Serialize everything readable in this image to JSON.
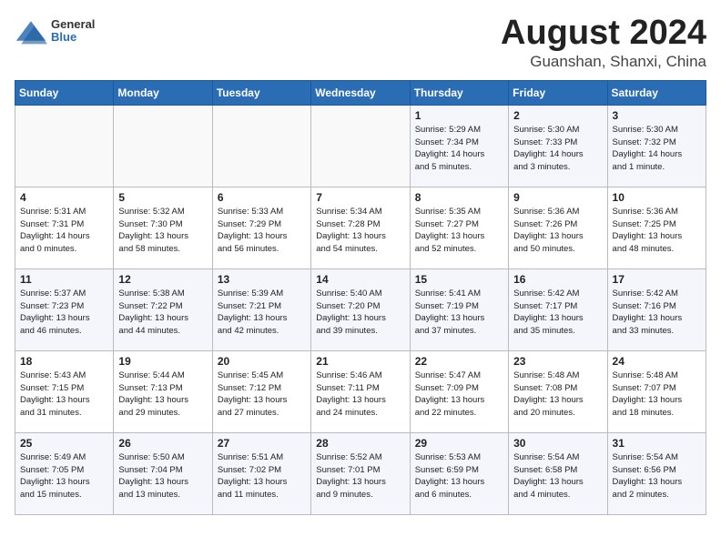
{
  "header": {
    "logo_general": "General",
    "logo_blue": "Blue",
    "month_title": "August 2024",
    "location": "Guanshan, Shanxi, China"
  },
  "days_of_week": [
    "Sunday",
    "Monday",
    "Tuesday",
    "Wednesday",
    "Thursday",
    "Friday",
    "Saturday"
  ],
  "weeks": [
    [
      {
        "day": "",
        "info": ""
      },
      {
        "day": "",
        "info": ""
      },
      {
        "day": "",
        "info": ""
      },
      {
        "day": "",
        "info": ""
      },
      {
        "day": "1",
        "info": "Sunrise: 5:29 AM\nSunset: 7:34 PM\nDaylight: 14 hours\nand 5 minutes."
      },
      {
        "day": "2",
        "info": "Sunrise: 5:30 AM\nSunset: 7:33 PM\nDaylight: 14 hours\nand 3 minutes."
      },
      {
        "day": "3",
        "info": "Sunrise: 5:30 AM\nSunset: 7:32 PM\nDaylight: 14 hours\nand 1 minute."
      }
    ],
    [
      {
        "day": "4",
        "info": "Sunrise: 5:31 AM\nSunset: 7:31 PM\nDaylight: 14 hours\nand 0 minutes."
      },
      {
        "day": "5",
        "info": "Sunrise: 5:32 AM\nSunset: 7:30 PM\nDaylight: 13 hours\nand 58 minutes."
      },
      {
        "day": "6",
        "info": "Sunrise: 5:33 AM\nSunset: 7:29 PM\nDaylight: 13 hours\nand 56 minutes."
      },
      {
        "day": "7",
        "info": "Sunrise: 5:34 AM\nSunset: 7:28 PM\nDaylight: 13 hours\nand 54 minutes."
      },
      {
        "day": "8",
        "info": "Sunrise: 5:35 AM\nSunset: 7:27 PM\nDaylight: 13 hours\nand 52 minutes."
      },
      {
        "day": "9",
        "info": "Sunrise: 5:36 AM\nSunset: 7:26 PM\nDaylight: 13 hours\nand 50 minutes."
      },
      {
        "day": "10",
        "info": "Sunrise: 5:36 AM\nSunset: 7:25 PM\nDaylight: 13 hours\nand 48 minutes."
      }
    ],
    [
      {
        "day": "11",
        "info": "Sunrise: 5:37 AM\nSunset: 7:23 PM\nDaylight: 13 hours\nand 46 minutes."
      },
      {
        "day": "12",
        "info": "Sunrise: 5:38 AM\nSunset: 7:22 PM\nDaylight: 13 hours\nand 44 minutes."
      },
      {
        "day": "13",
        "info": "Sunrise: 5:39 AM\nSunset: 7:21 PM\nDaylight: 13 hours\nand 42 minutes."
      },
      {
        "day": "14",
        "info": "Sunrise: 5:40 AM\nSunset: 7:20 PM\nDaylight: 13 hours\nand 39 minutes."
      },
      {
        "day": "15",
        "info": "Sunrise: 5:41 AM\nSunset: 7:19 PM\nDaylight: 13 hours\nand 37 minutes."
      },
      {
        "day": "16",
        "info": "Sunrise: 5:42 AM\nSunset: 7:17 PM\nDaylight: 13 hours\nand 35 minutes."
      },
      {
        "day": "17",
        "info": "Sunrise: 5:42 AM\nSunset: 7:16 PM\nDaylight: 13 hours\nand 33 minutes."
      }
    ],
    [
      {
        "day": "18",
        "info": "Sunrise: 5:43 AM\nSunset: 7:15 PM\nDaylight: 13 hours\nand 31 minutes."
      },
      {
        "day": "19",
        "info": "Sunrise: 5:44 AM\nSunset: 7:13 PM\nDaylight: 13 hours\nand 29 minutes."
      },
      {
        "day": "20",
        "info": "Sunrise: 5:45 AM\nSunset: 7:12 PM\nDaylight: 13 hours\nand 27 minutes."
      },
      {
        "day": "21",
        "info": "Sunrise: 5:46 AM\nSunset: 7:11 PM\nDaylight: 13 hours\nand 24 minutes."
      },
      {
        "day": "22",
        "info": "Sunrise: 5:47 AM\nSunset: 7:09 PM\nDaylight: 13 hours\nand 22 minutes."
      },
      {
        "day": "23",
        "info": "Sunrise: 5:48 AM\nSunset: 7:08 PM\nDaylight: 13 hours\nand 20 minutes."
      },
      {
        "day": "24",
        "info": "Sunrise: 5:48 AM\nSunset: 7:07 PM\nDaylight: 13 hours\nand 18 minutes."
      }
    ],
    [
      {
        "day": "25",
        "info": "Sunrise: 5:49 AM\nSunset: 7:05 PM\nDaylight: 13 hours\nand 15 minutes."
      },
      {
        "day": "26",
        "info": "Sunrise: 5:50 AM\nSunset: 7:04 PM\nDaylight: 13 hours\nand 13 minutes."
      },
      {
        "day": "27",
        "info": "Sunrise: 5:51 AM\nSunset: 7:02 PM\nDaylight: 13 hours\nand 11 minutes."
      },
      {
        "day": "28",
        "info": "Sunrise: 5:52 AM\nSunset: 7:01 PM\nDaylight: 13 hours\nand 9 minutes."
      },
      {
        "day": "29",
        "info": "Sunrise: 5:53 AM\nSunset: 6:59 PM\nDaylight: 13 hours\nand 6 minutes."
      },
      {
        "day": "30",
        "info": "Sunrise: 5:54 AM\nSunset: 6:58 PM\nDaylight: 13 hours\nand 4 minutes."
      },
      {
        "day": "31",
        "info": "Sunrise: 5:54 AM\nSunset: 6:56 PM\nDaylight: 13 hours\nand 2 minutes."
      }
    ]
  ]
}
